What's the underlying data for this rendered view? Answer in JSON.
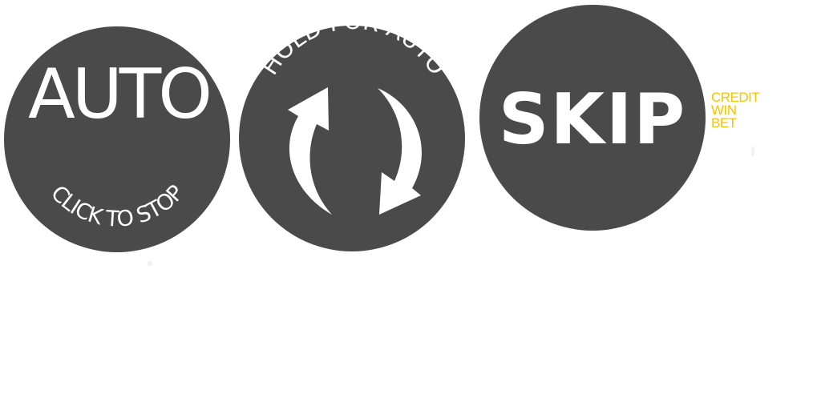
{
  "buttons": {
    "auto": {
      "label": "AUTO",
      "sublabel": "CLICK TO STOP"
    },
    "hold": {
      "label": "HOLD FOR AUTO",
      "icon": "refresh-arrows-icon"
    },
    "skip": {
      "label": "SKIP"
    }
  },
  "legend": {
    "credit_label": "CREDIT",
    "win_label": "WIN",
    "bet_label": "BET"
  },
  "colors": {
    "button_fill": "#4a4a4a",
    "button_text": "#ffffff",
    "legend_text": "#f5c400",
    "background": "#ffffff"
  }
}
